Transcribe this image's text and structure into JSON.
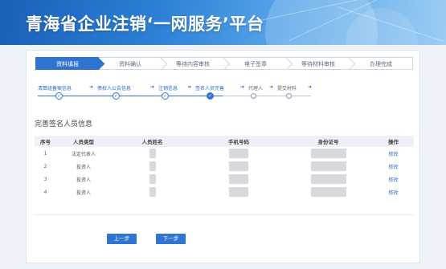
{
  "banner": {
    "title": "青海省企业注销‘一网服务’平台"
  },
  "steps": [
    {
      "label": "资料填报",
      "active": true
    },
    {
      "label": "资料确认",
      "active": false
    },
    {
      "label": "等待内容审核",
      "active": false
    },
    {
      "label": "电子签章",
      "active": false
    },
    {
      "label": "等待材料审核",
      "active": false
    },
    {
      "label": "办理完成",
      "active": false
    }
  ],
  "substeps": [
    {
      "label": "清算组备案信息",
      "status": "done"
    },
    {
      "label": "债权人公告信息",
      "status": "done"
    },
    {
      "label": "注销信息",
      "status": "done"
    },
    {
      "label": "签名人员完善",
      "status": "current"
    },
    {
      "label": "代理人",
      "status": "pending"
    },
    {
      "label": "提交材料",
      "status": "pending"
    }
  ],
  "section_title": "完善签名人员信息",
  "table": {
    "headers": [
      "序号",
      "人员类型",
      "人员姓名",
      "手机号码",
      "身份证号",
      "操作"
    ],
    "rows": [
      {
        "index": "1",
        "type": "法定代表人",
        "action": "修改"
      },
      {
        "index": "2",
        "type": "投资人",
        "action": "修改"
      },
      {
        "index": "3",
        "type": "投资人",
        "action": "修改"
      },
      {
        "index": "4",
        "type": "投资人",
        "action": "修改"
      }
    ]
  },
  "buttons": {
    "prev": "上一步",
    "next": "下一步"
  },
  "colors": {
    "primary": "#2f73d3",
    "link": "#2a6bbf"
  },
  "icons": {
    "done": "check-icon",
    "current": "check-icon"
  }
}
